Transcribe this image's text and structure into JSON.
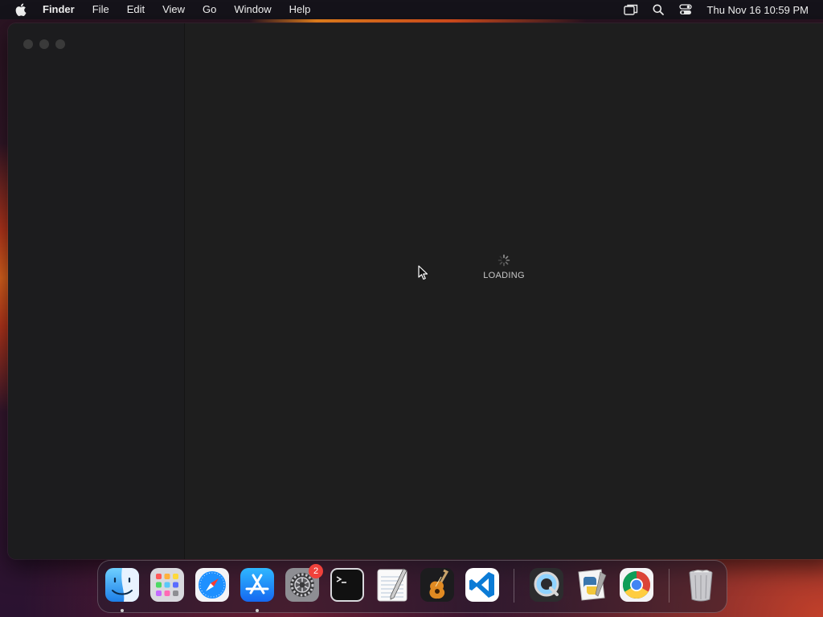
{
  "menubar": {
    "app_name": "Finder",
    "items": [
      "File",
      "Edit",
      "View",
      "Go",
      "Window",
      "Help"
    ],
    "clock": "Thu Nov 16  10:59 PM",
    "status_icons": [
      "screen-mirroring-icon",
      "spotlight-search-icon",
      "control-center-icon"
    ]
  },
  "window": {
    "traffic_lights": [
      "close",
      "minimize",
      "zoom"
    ],
    "loading_label": "LOADING"
  },
  "dock": {
    "apps": [
      {
        "name": "Finder",
        "icon": "finder-icon",
        "running": true
      },
      {
        "name": "Launchpad",
        "icon": "launchpad-icon",
        "running": false
      },
      {
        "name": "Safari",
        "icon": "safari-icon",
        "running": false
      },
      {
        "name": "App Store",
        "icon": "app-store-icon",
        "running": true
      },
      {
        "name": "System Settings",
        "icon": "system-settings-icon",
        "running": false,
        "badge": "2"
      },
      {
        "name": "Terminal",
        "icon": "terminal-icon",
        "running": false
      },
      {
        "name": "TextEdit",
        "icon": "textedit-icon",
        "running": false
      },
      {
        "name": "GarageBand",
        "icon": "garageband-icon",
        "running": false
      },
      {
        "name": "Visual Studio Code",
        "icon": "vscode-icon",
        "running": false
      },
      {
        "name": "QuickTime Player",
        "icon": "quicktime-icon",
        "running": false
      },
      {
        "name": "Python Launcher",
        "icon": "python-launcher-icon",
        "running": false
      },
      {
        "name": "Google Chrome",
        "icon": "chrome-icon",
        "running": false
      },
      {
        "name": "Trash",
        "icon": "trash-icon",
        "running": false
      }
    ]
  },
  "colors": {
    "menubar_bg": "#15131a",
    "window_bg": "#1e1e1e",
    "sidebar_bg": "#1c1c1e",
    "badge_red": "#f0413b"
  }
}
